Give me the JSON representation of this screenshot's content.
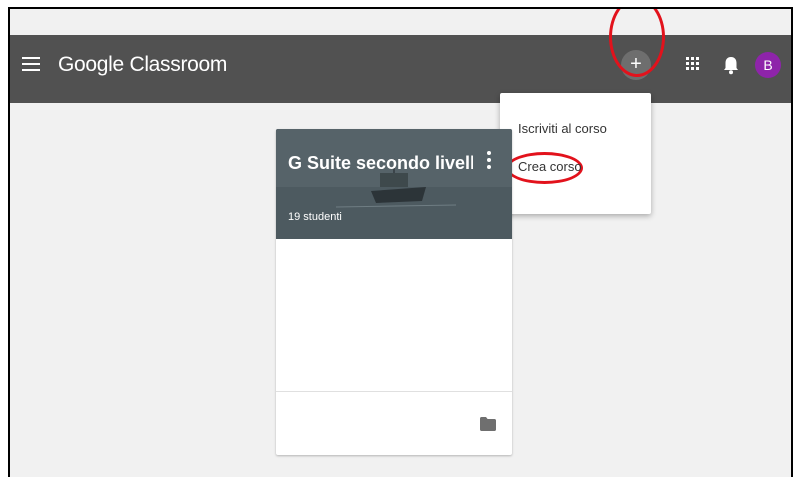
{
  "header": {
    "app_name": "Google Classroom",
    "add_label": "+",
    "avatar_initial": "B"
  },
  "dropdown": {
    "items": [
      {
        "label": "Iscriviti al corso"
      },
      {
        "label": "Crea corso"
      }
    ]
  },
  "course_card": {
    "title": "G Suite secondo livello...",
    "students": "19 studenti"
  },
  "colors": {
    "topbar": "#515151",
    "avatar": "#8e24aa",
    "highlight_ring": "#e2121c"
  }
}
